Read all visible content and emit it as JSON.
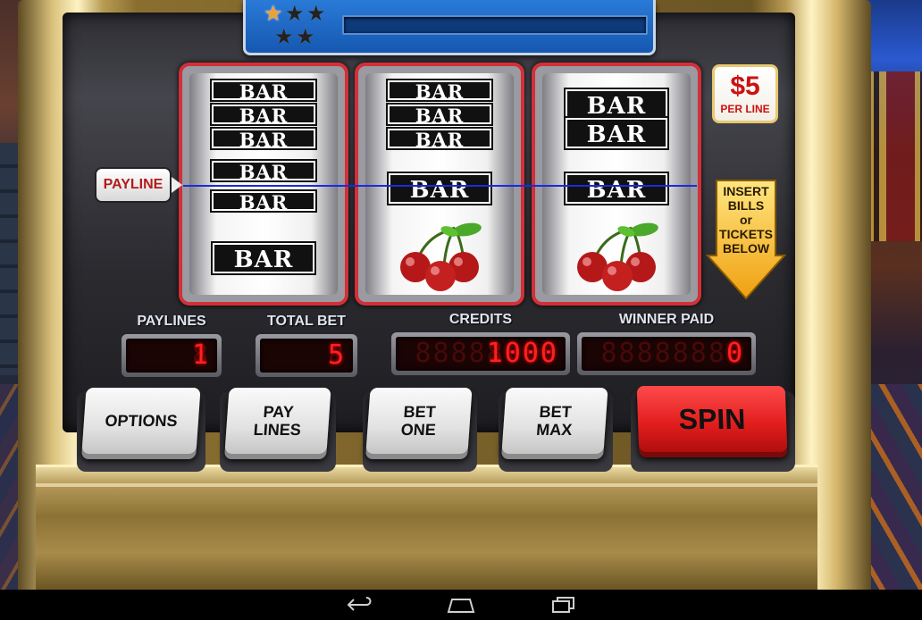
{
  "progress": {
    "stars_total": 5,
    "stars_earned": 1,
    "level_fill": 0
  },
  "reels": [
    {
      "symbols": [
        "BAR",
        "BAR",
        "BAR",
        "BAR",
        "BAR",
        "BAR"
      ]
    },
    {
      "symbols": [
        "BAR",
        "BAR",
        "BAR",
        "BAR",
        "cherries"
      ]
    },
    {
      "symbols": [
        "BAR",
        "BAR",
        "BAR",
        "cherries"
      ]
    }
  ],
  "payline_label": "PAYLINE",
  "price": {
    "amount": "$5",
    "unit": "PER LINE"
  },
  "insert_sign": [
    "INSERT",
    "BILLS",
    "or",
    "TICKETS",
    "BELOW"
  ],
  "meters": {
    "paylines": {
      "label": "PAYLINES",
      "value": "1",
      "ghost": "8"
    },
    "total_bet": {
      "label": "TOTAL BET",
      "value": "5",
      "ghost": "8"
    },
    "credits": {
      "label": "CREDITS",
      "value": "1000",
      "ghost": "88888888"
    },
    "winner_paid": {
      "label": "WINNER PAID",
      "value": "0",
      "ghost": "88888888"
    }
  },
  "buttons": {
    "options": [
      "OPTIONS"
    ],
    "pay_lines": [
      "PAY",
      "LINES"
    ],
    "bet_one": [
      "BET",
      "ONE"
    ],
    "bet_max": [
      "BET",
      "MAX"
    ],
    "spin": [
      "SPIN"
    ]
  },
  "colors": {
    "reel_border": "#d23038",
    "led": "#ff2020",
    "spin_button": "#e01c1c",
    "top_panel": "#1558b0",
    "star_active": "#f0a030"
  },
  "icons": {
    "nav_back": "back-arrow-icon",
    "nav_home": "home-icon",
    "nav_recents": "recent-apps-icon"
  }
}
